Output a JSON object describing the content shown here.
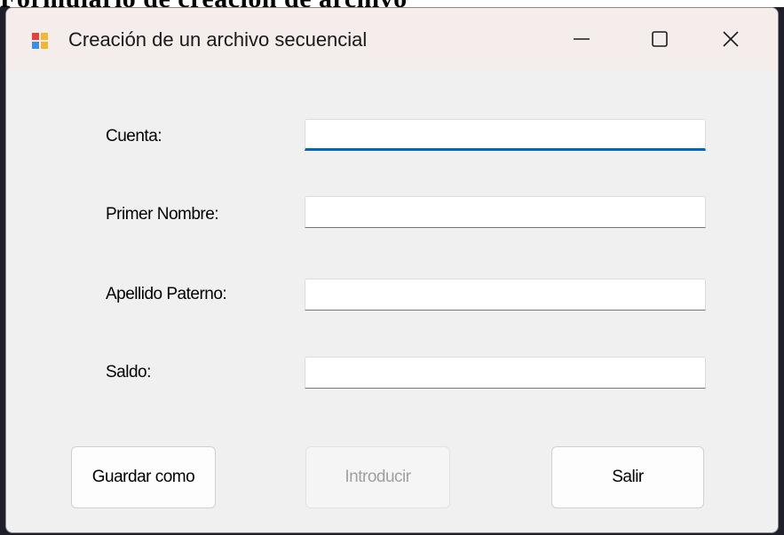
{
  "background": {
    "doc_heading": "Formulario de creación de archivo"
  },
  "window": {
    "title": "Creación de un archivo secuencial",
    "icon": "windows-form-icon",
    "controls": {
      "minimize": "minimize-icon",
      "maximize": "maximize-icon",
      "close": "close-icon"
    }
  },
  "form": {
    "fields": [
      {
        "label": "Cuenta:",
        "value": "",
        "focused": true
      },
      {
        "label": "Primer Nombre:",
        "value": ""
      },
      {
        "label": "Apellido Paterno:",
        "value": ""
      },
      {
        "label": "Saldo:",
        "value": ""
      }
    ]
  },
  "buttons": {
    "save_as": "Guardar como",
    "enter": "Introducir",
    "enter_enabled": false,
    "exit": "Salir"
  },
  "colors": {
    "focus_accent": "#0067c0",
    "titlebar": "#f5ecec",
    "window_bg": "#f0f0f0"
  }
}
